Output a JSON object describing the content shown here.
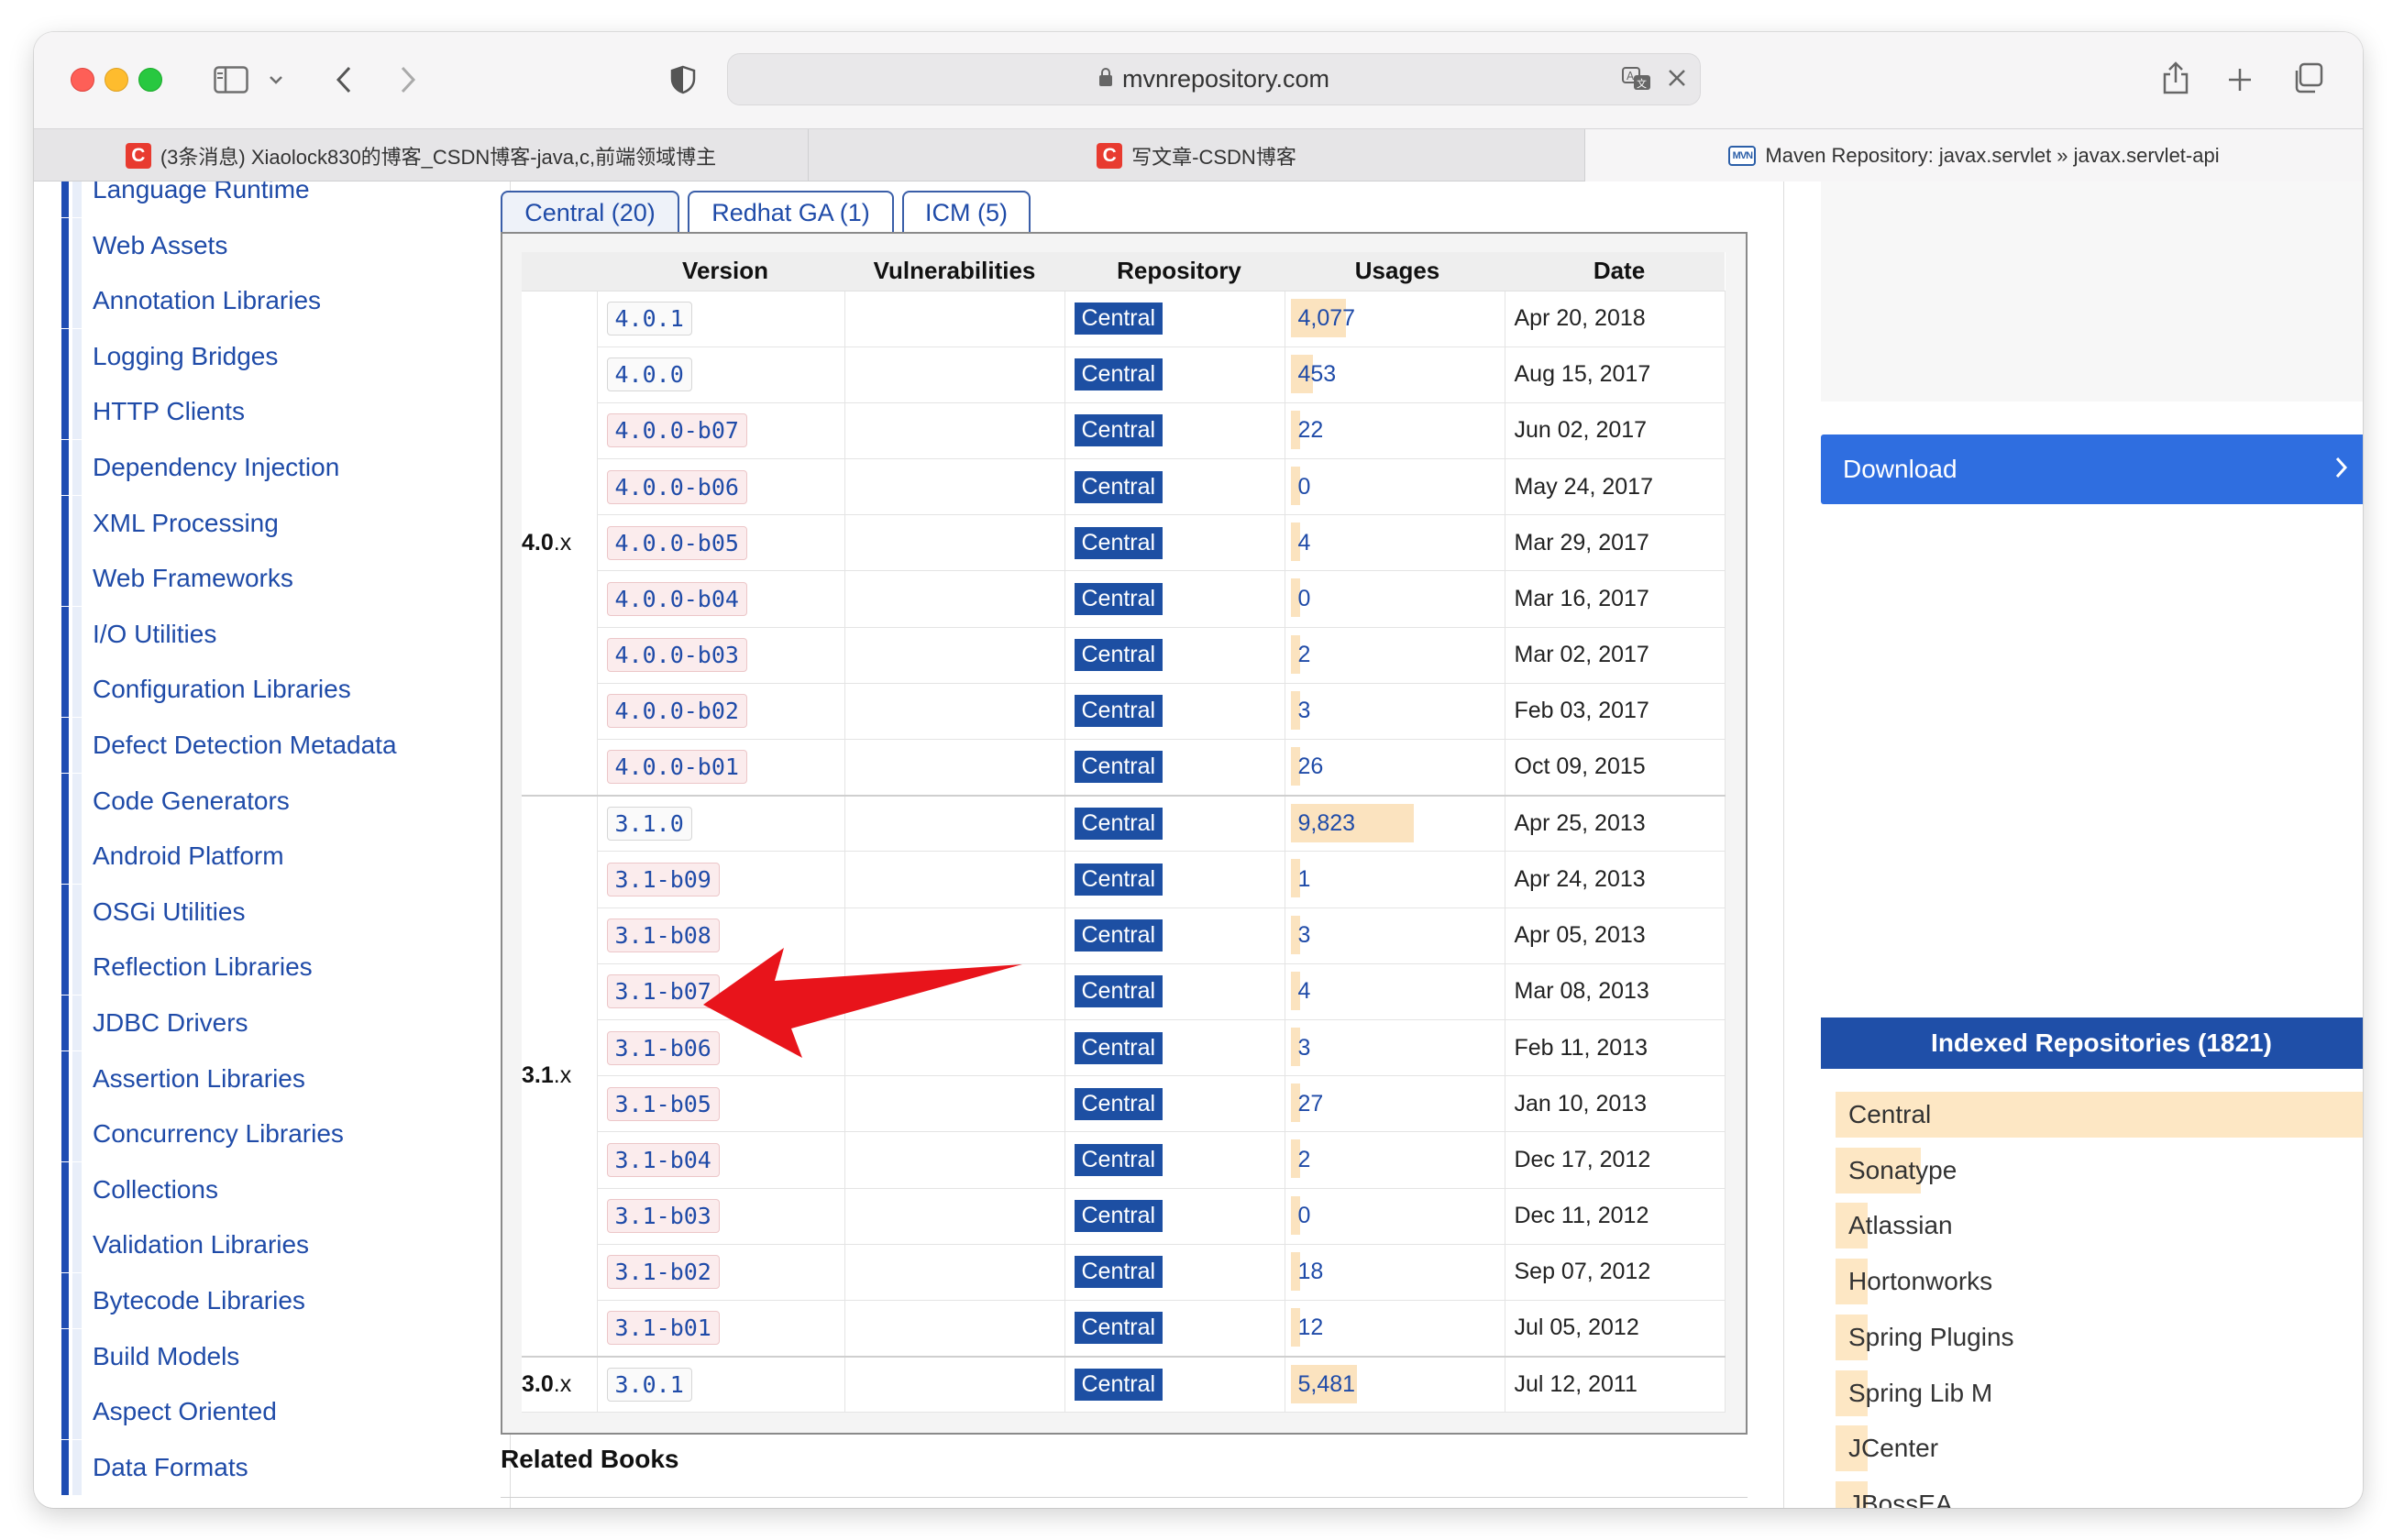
{
  "browser": {
    "url": "mvnrepository.com",
    "tabs": [
      {
        "title": "(3条消息) Xiaolock830的博客_CSDN博客-java,c,前端领域博主"
      },
      {
        "title": "写文章-CSDN博客"
      },
      {
        "title": "Maven Repository: javax.servlet » javax.servlet-api"
      }
    ],
    "favicons": {
      "csdn": "C",
      "mvn": "MVN"
    }
  },
  "sidebar": {
    "items": [
      "Language Runtime",
      "Web Assets",
      "Annotation Libraries",
      "Logging Bridges",
      "HTTP Clients",
      "Dependency Injection",
      "XML Processing",
      "Web Frameworks",
      "I/O Utilities",
      "Configuration Libraries",
      "Defect Detection Metadata",
      "Code Generators",
      "Android Platform",
      "OSGi Utilities",
      "Reflection Libraries",
      "JDBC Drivers",
      "Assertion Libraries",
      "Concurrency Libraries",
      "Collections",
      "Validation Libraries",
      "Bytecode Libraries",
      "Build Models",
      "Aspect Oriented",
      "Data Formats"
    ]
  },
  "repo_tabs": [
    "Central (20)",
    "Redhat GA (1)",
    "ICM (5)"
  ],
  "table": {
    "headers": [
      "Version",
      "Vulnerabilities",
      "Repository",
      "Usages",
      "Date"
    ],
    "groups": [
      {
        "label_bold": "4.0",
        "label_rest": ".x",
        "rows": [
          {
            "version": "4.0.1",
            "repo": "Central",
            "usages": "4,077",
            "usage_frac": 0.25,
            "date": "Apr 20, 2018",
            "beta": false
          },
          {
            "version": "4.0.0",
            "repo": "Central",
            "usages": "453",
            "usage_frac": 0.1,
            "date": "Aug 15, 2017",
            "beta": false
          },
          {
            "version": "4.0.0-b07",
            "repo": "Central",
            "usages": "22",
            "usage_frac": 0.04,
            "date": "Jun 02, 2017",
            "beta": true
          },
          {
            "version": "4.0.0-b06",
            "repo": "Central",
            "usages": "0",
            "usage_frac": 0.04,
            "date": "May 24, 2017",
            "beta": true
          },
          {
            "version": "4.0.0-b05",
            "repo": "Central",
            "usages": "4",
            "usage_frac": 0.04,
            "date": "Mar 29, 2017",
            "beta": true
          },
          {
            "version": "4.0.0-b04",
            "repo": "Central",
            "usages": "0",
            "usage_frac": 0.04,
            "date": "Mar 16, 2017",
            "beta": true
          },
          {
            "version": "4.0.0-b03",
            "repo": "Central",
            "usages": "2",
            "usage_frac": 0.04,
            "date": "Mar 02, 2017",
            "beta": true
          },
          {
            "version": "4.0.0-b02",
            "repo": "Central",
            "usages": "3",
            "usage_frac": 0.04,
            "date": "Feb 03, 2017",
            "beta": true
          },
          {
            "version": "4.0.0-b01",
            "repo": "Central",
            "usages": "26",
            "usage_frac": 0.04,
            "date": "Oct 09, 2015",
            "beta": true
          }
        ]
      },
      {
        "label_bold": "3.1",
        "label_rest": ".x",
        "rows": [
          {
            "version": "3.1.0",
            "repo": "Central",
            "usages": "9,823",
            "usage_frac": 0.56,
            "date": "Apr 25, 2013",
            "beta": false
          },
          {
            "version": "3.1-b09",
            "repo": "Central",
            "usages": "1",
            "usage_frac": 0.04,
            "date": "Apr 24, 2013",
            "beta": true
          },
          {
            "version": "3.1-b08",
            "repo": "Central",
            "usages": "3",
            "usage_frac": 0.04,
            "date": "Apr 05, 2013",
            "beta": true
          },
          {
            "version": "3.1-b07",
            "repo": "Central",
            "usages": "4",
            "usage_frac": 0.04,
            "date": "Mar 08, 2013",
            "beta": true
          },
          {
            "version": "3.1-b06",
            "repo": "Central",
            "usages": "3",
            "usage_frac": 0.04,
            "date": "Feb 11, 2013",
            "beta": true
          },
          {
            "version": "3.1-b05",
            "repo": "Central",
            "usages": "27",
            "usage_frac": 0.04,
            "date": "Jan 10, 2013",
            "beta": true
          },
          {
            "version": "3.1-b04",
            "repo": "Central",
            "usages": "2",
            "usage_frac": 0.04,
            "date": "Dec 17, 2012",
            "beta": true
          },
          {
            "version": "3.1-b03",
            "repo": "Central",
            "usages": "0",
            "usage_frac": 0.04,
            "date": "Dec 11, 2012",
            "beta": true
          },
          {
            "version": "3.1-b02",
            "repo": "Central",
            "usages": "18",
            "usage_frac": 0.04,
            "date": "Sep 07, 2012",
            "beta": true
          },
          {
            "version": "3.1-b01",
            "repo": "Central",
            "usages": "12",
            "usage_frac": 0.04,
            "date": "Jul 05, 2012",
            "beta": true
          }
        ]
      },
      {
        "label_bold": "3.0",
        "label_rest": ".x",
        "rows": [
          {
            "version": "3.0.1",
            "repo": "Central",
            "usages": "5,481",
            "usage_frac": 0.3,
            "date": "Jul 12, 2011",
            "beta": false
          }
        ]
      }
    ]
  },
  "related_books": "Related Books",
  "right": {
    "download": "Download",
    "indexed_title": "Indexed Repositories (1821)",
    "repos": [
      {
        "name": "Central",
        "frac": 1.0
      },
      {
        "name": "Sonatype",
        "frac": 0.16
      },
      {
        "name": "Atlassian",
        "frac": 0.06
      },
      {
        "name": "Hortonworks",
        "frac": 0.06
      },
      {
        "name": "Spring Plugins",
        "frac": 0.06
      },
      {
        "name": "Spring Lib M",
        "frac": 0.06
      },
      {
        "name": "JCenter",
        "frac": 0.06
      },
      {
        "name": "JBossEA",
        "frac": 0.06
      }
    ]
  },
  "colors": {
    "brand_blue": "#1f4fa8",
    "download_blue": "#2f6ee0",
    "usage_bar": "#fbe3bf",
    "arrow_red": "#e8141b"
  }
}
